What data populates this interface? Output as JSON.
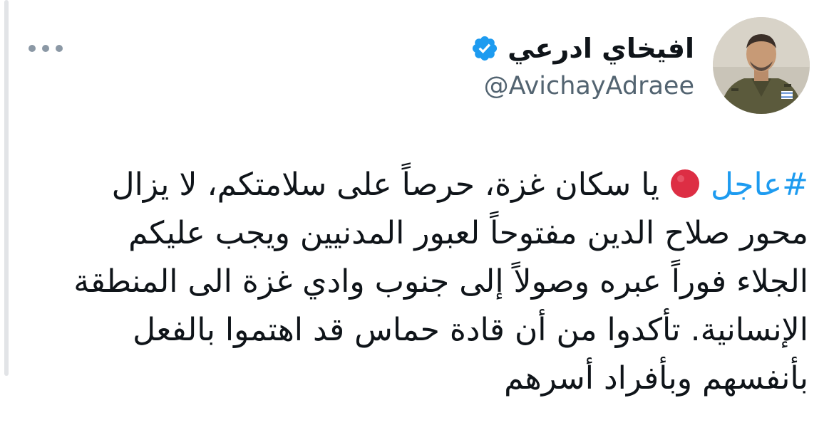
{
  "author": {
    "display_name": "افيخاي ادرعي",
    "handle": "@AvichayAdraee",
    "verified": true,
    "verified_color": "#1d9bf0"
  },
  "header": {
    "more_icon": "more-horizontal-icon"
  },
  "tweet": {
    "hashtag": "#عاجل",
    "emoji": "red-circle-icon",
    "emoji_color": "#dd2e44",
    "line1_text": "يا سكان غزة، حرصاً على سلامتكم، لا يزال",
    "line2_text": "محور صلاح الدين مفتوحاً لعبور المدنيين ويجب عليكم",
    "line3_text": "الجلاء فوراً عبره وصولاً إلى جنوب وادي غزة الى المنطقة",
    "line4_text": "الإنسانية. تأكدوا من أن قادة حماس قد اهتموا بالفعل",
    "line5_text": "بأنفسهم وبأفراد أسرهم"
  },
  "colors": {
    "text": "#0f1419",
    "secondary": "#536471",
    "link": "#1d9bf0"
  }
}
